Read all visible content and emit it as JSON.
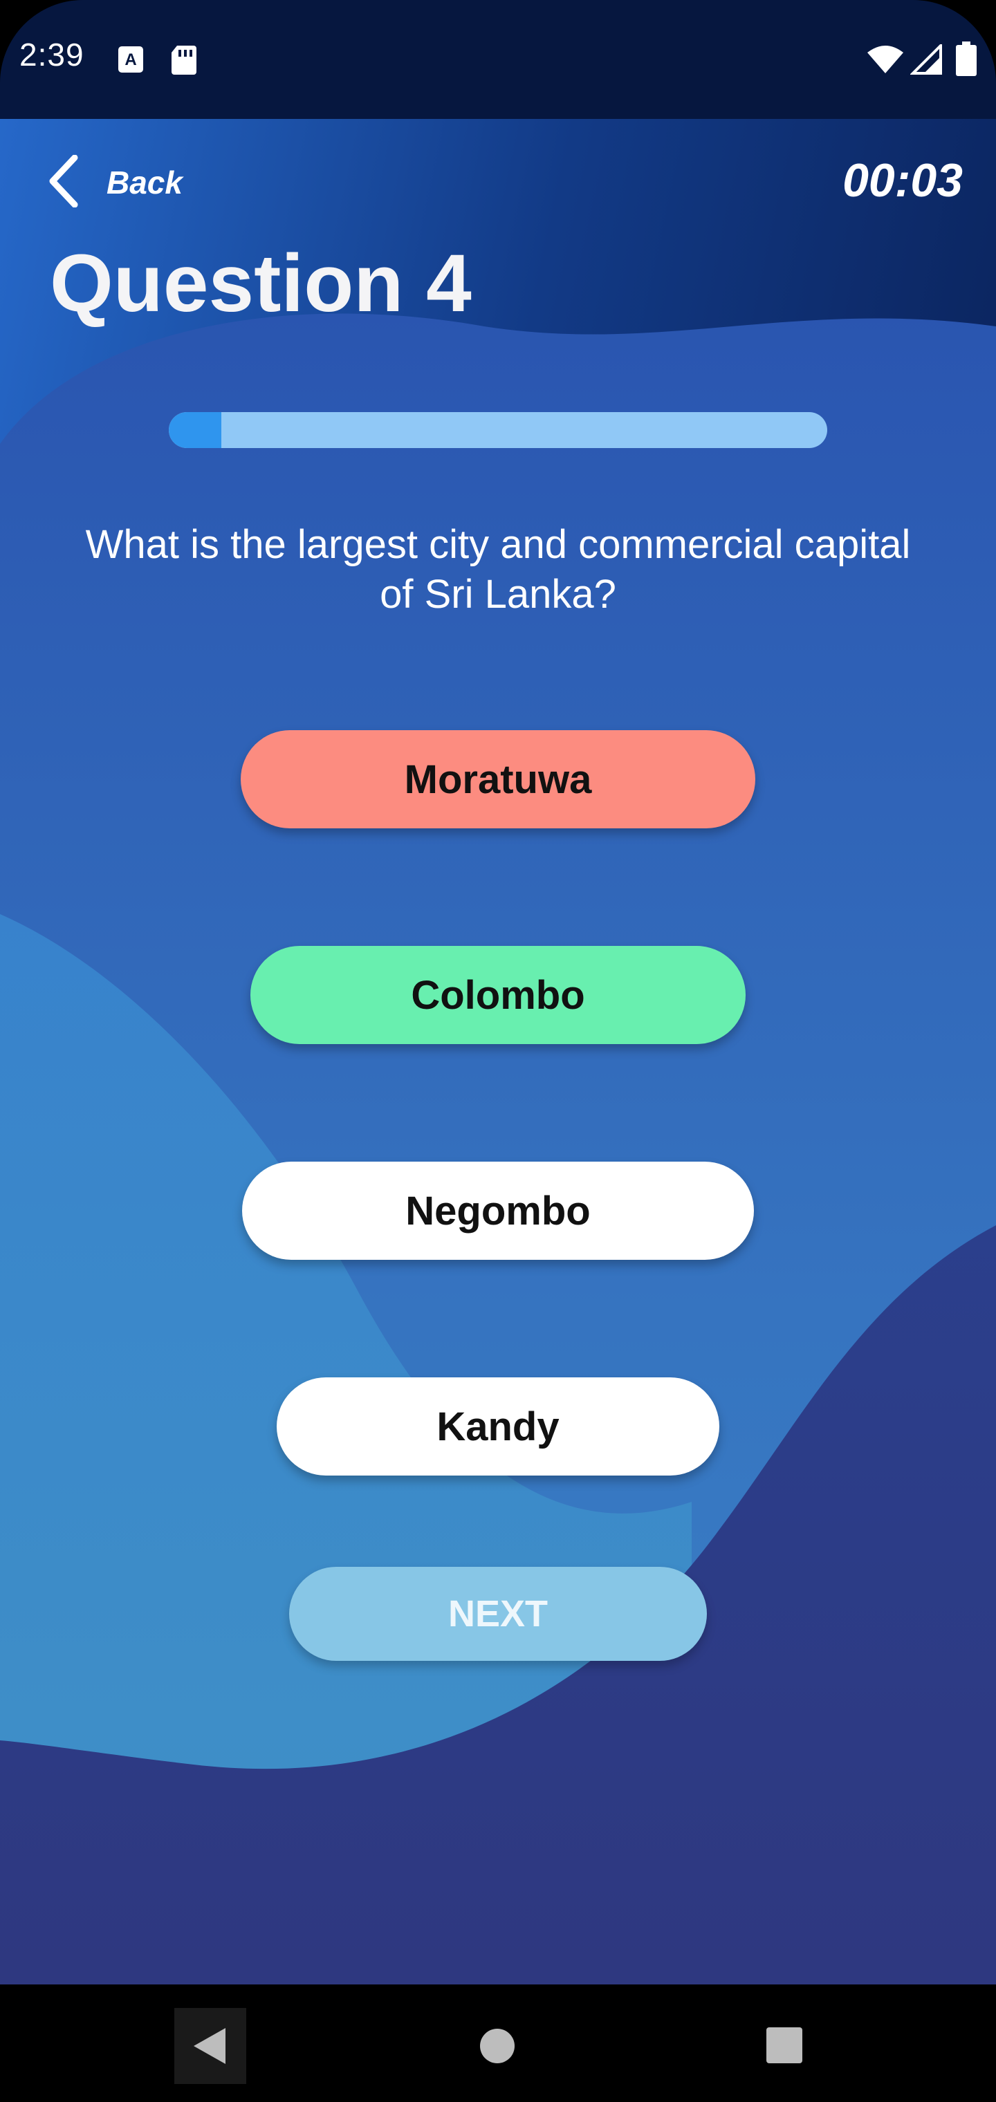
{
  "status_bar": {
    "time": "2:39",
    "icons": [
      "a-keyboard-icon",
      "sd-card-icon",
      "wifi-icon",
      "signal-icon",
      "battery-icon"
    ]
  },
  "header": {
    "back_label": "Back",
    "timer": "00:03"
  },
  "question": {
    "title": "Question 4",
    "text": "What is the largest city and commercial capital of Sri Lanka?",
    "progress_fraction": 0.08
  },
  "answers": [
    {
      "label": "Moratuwa",
      "state": "incorrect",
      "color": "#fc8c80"
    },
    {
      "label": "Colombo",
      "state": "correct",
      "color": "#68efaf"
    },
    {
      "label": "Negombo",
      "state": "default",
      "color": "#ffffff"
    },
    {
      "label": "Kandy",
      "state": "default",
      "color": "#ffffff"
    }
  ],
  "next_button": {
    "label": "NEXT",
    "color": "#87c6e6"
  },
  "colors": {
    "status_bar_bg": "#06173f",
    "bg_dark_navy": "#0b2560",
    "bg_blue": "#2a63bb",
    "bg_light_blue": "#3b8fcf",
    "bg_indigo": "#2d3b82",
    "progress_track": "#90c8f6",
    "progress_fill": "#2f95ee"
  },
  "nav_bar": {
    "icons": [
      "nav-back-icon",
      "nav-home-icon",
      "nav-recents-icon"
    ]
  }
}
